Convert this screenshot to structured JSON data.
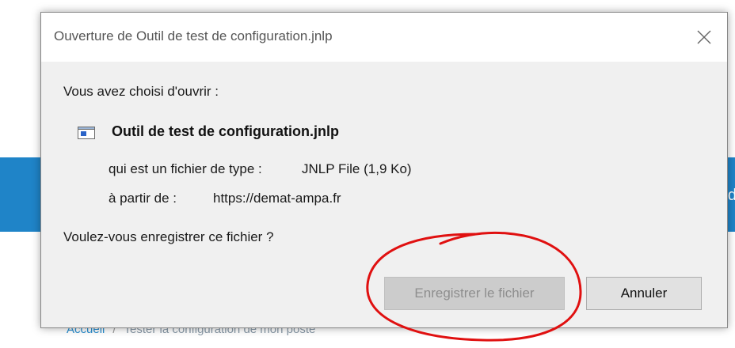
{
  "background": {
    "band_text": "d",
    "breadcrumb": [
      "Accueil",
      "Tester la configuration de mon poste"
    ]
  },
  "dialog": {
    "title": "Ouverture de Outil de test de configuration.jnlp",
    "intro": "Vous avez choisi d'ouvrir :",
    "file_name": "Outil de test de configuration.jnlp",
    "type_label": "qui est un fichier de type :",
    "type_value": "JNLP File (1,9 Ko)",
    "source_label": "à partir de :",
    "source_value": "https://demat-ampa.fr",
    "question": "Voulez-vous enregistrer ce fichier ?",
    "save_button": "Enregistrer le fichier",
    "cancel_button": "Annuler",
    "close_icon": "close-icon",
    "file_icon": "window-file-icon"
  },
  "colors": {
    "band_blue": "#1f84c8",
    "dialog_bg": "#f0f0f0",
    "annotation_red": "#e01010"
  }
}
